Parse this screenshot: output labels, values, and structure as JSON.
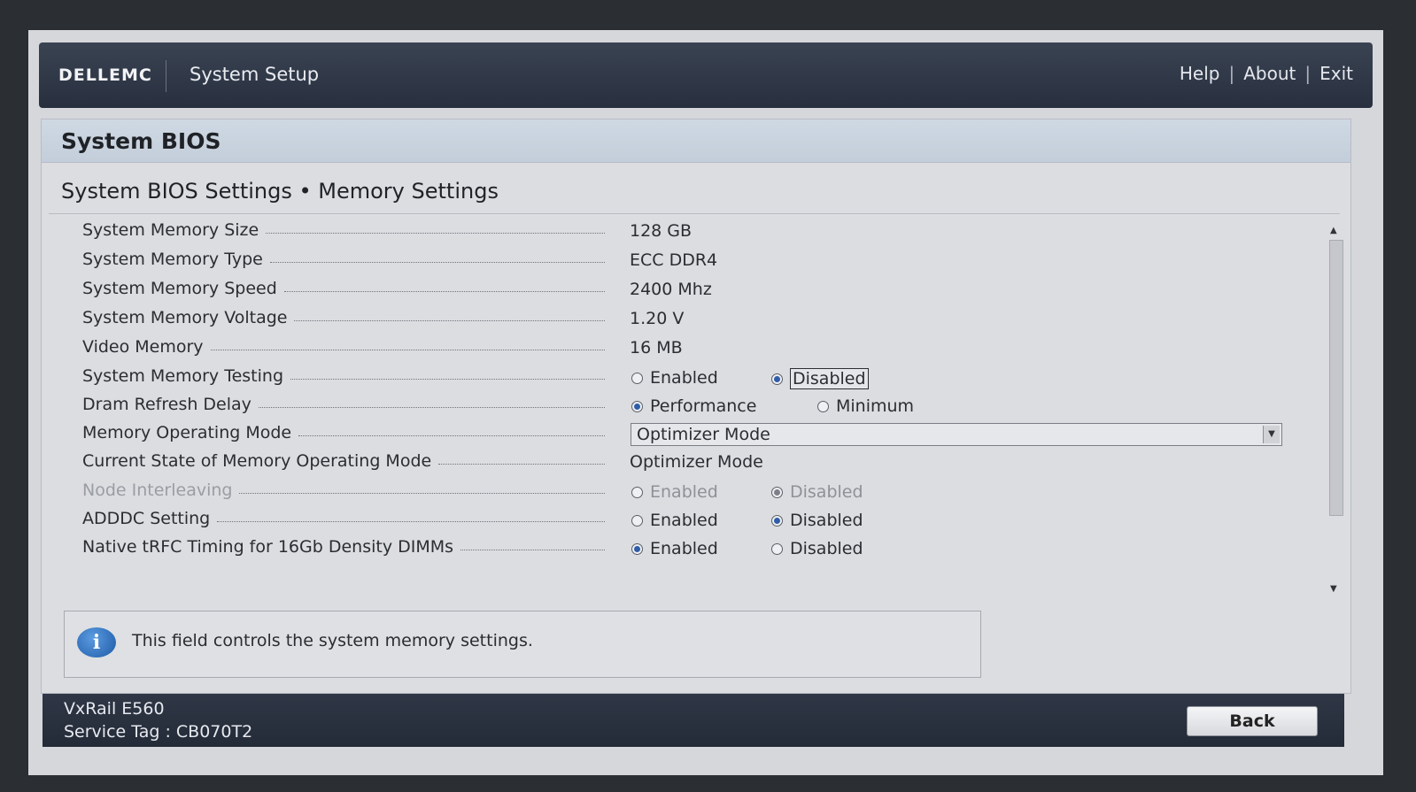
{
  "header": {
    "logo": "DELLEMC",
    "app_title": "System Setup",
    "links": [
      "Help",
      "About",
      "Exit"
    ],
    "separator": "|"
  },
  "panel": {
    "title": "System BIOS",
    "breadcrumb": "System BIOS Settings • Memory Settings"
  },
  "settings": {
    "memory_size": {
      "label": "System Memory Size",
      "value": "128 GB"
    },
    "memory_type": {
      "label": "System Memory Type",
      "value": "ECC DDR4"
    },
    "memory_speed": {
      "label": "System Memory Speed",
      "value": "2400 Mhz"
    },
    "memory_voltage": {
      "label": "System Memory Voltage",
      "value": "1.20 V"
    },
    "video_memory": {
      "label": "Video Memory",
      "value": "16 MB"
    },
    "memory_testing": {
      "label": "System Memory Testing",
      "opt1": "Enabled",
      "opt2": "Disabled",
      "selected": "Disabled"
    },
    "dram_refresh": {
      "label": "Dram Refresh Delay",
      "opt1": "Performance",
      "opt2": "Minimum",
      "selected": "Performance"
    },
    "operating_mode": {
      "label": "Memory Operating Mode",
      "value": "Optimizer Mode"
    },
    "current_mode": {
      "label": "Current State of Memory Operating Mode",
      "value": "Optimizer Mode"
    },
    "node_interleaving": {
      "label": "Node Interleaving",
      "opt1": "Enabled",
      "opt2": "Disabled",
      "selected": "Disabled",
      "disabled": true
    },
    "adddc": {
      "label": "ADDDC Setting",
      "opt1": "Enabled",
      "opt2": "Disabled",
      "selected": "Disabled"
    },
    "native_trfc": {
      "label": "Native tRFC Timing for 16Gb Density DIMMs",
      "opt1": "Enabled",
      "opt2": "Disabled",
      "selected": "Enabled"
    }
  },
  "info": {
    "icon": "info-icon",
    "text": "This field controls the system memory settings."
  },
  "footer": {
    "model": "VxRail E560",
    "service_tag": "Service Tag : CB070T2",
    "back_label": "Back"
  },
  "colors": {
    "header_bg": "#2f3746",
    "panel_bg": "#dcdde1",
    "radio_selected": "#2f5da8"
  }
}
